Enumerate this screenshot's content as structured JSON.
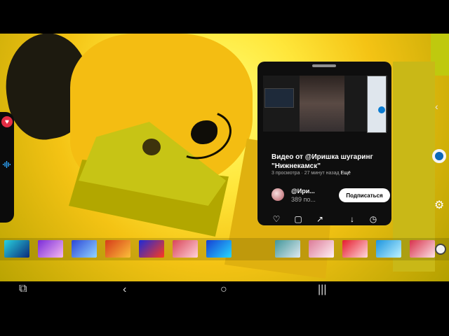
{
  "video_popup": {
    "title": "Видео от @Иришка шугаринг \"Нижнекамск\"",
    "views": "3 просмотра",
    "time": "27 минут назад",
    "more": "Ещё",
    "channel_name": "@Ири...",
    "subscribers": "389 по...",
    "subscribe_label": "Подписаться"
  },
  "icons": {
    "heart": "heart-icon",
    "waveform": "audio-wave-icon",
    "back_chevron": "chevron-left-icon",
    "camera_target": "record-target-icon",
    "settings": "gear-icon",
    "like": "like-icon",
    "comment": "comment-icon",
    "share": "share-icon",
    "download": "download-icon",
    "clock": "clock-icon",
    "nav_screenshot": "screenshot-icon",
    "nav_back": "back-icon",
    "nav_home": "home-icon",
    "nav_recents": "recents-icon"
  },
  "colors": {
    "accent_red": "#e32d44",
    "accent_blue": "#0b67b8",
    "popup_bg": "#0e0e0e"
  },
  "effect_tiles": [
    {
      "name": "tile-1",
      "color": "#28d2df"
    },
    {
      "name": "tile-2",
      "color": "#7a2bd9"
    },
    {
      "name": "tile-3",
      "color": "#2c47d8"
    },
    {
      "name": "tile-4",
      "color": "#d63b1a"
    },
    {
      "name": "tile-5",
      "color": "#1c2ad9"
    },
    {
      "name": "tile-6",
      "color": "#d9465a"
    },
    {
      "name": "tile-7",
      "color": "#163fd4"
    },
    {
      "name": "tile-8",
      "color": "#42979b"
    },
    {
      "name": "tile-9",
      "color": "#dc7a98"
    },
    {
      "name": "tile-10",
      "color": "#e51c2e"
    },
    {
      "name": "tile-11",
      "color": "#1c95df"
    },
    {
      "name": "tile-12",
      "color": "#d8324c"
    }
  ]
}
